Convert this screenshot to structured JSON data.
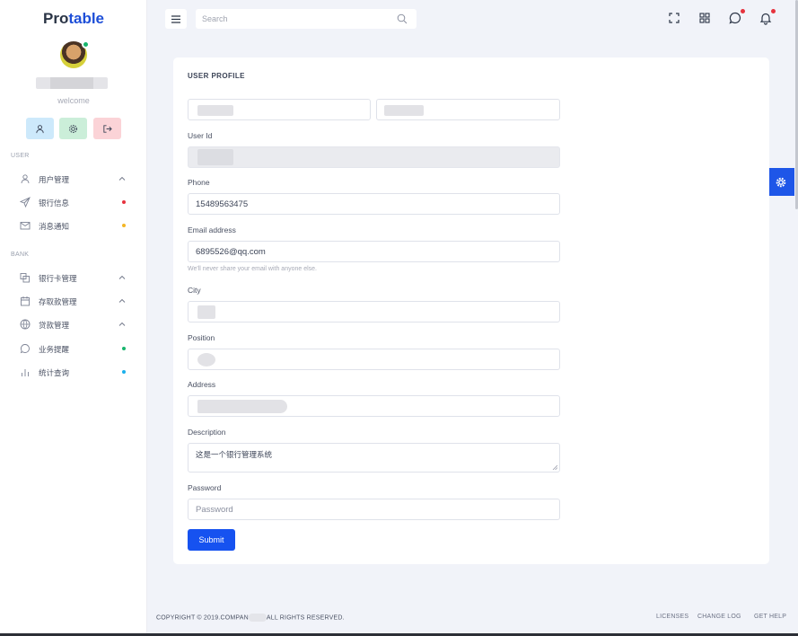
{
  "app": {
    "brand_prefix": "Pro",
    "brand_suffix": "table"
  },
  "profile": {
    "welcome": "welcome"
  },
  "sidebar": {
    "section_user": "USER",
    "section_bank": "BANK",
    "items": [
      {
        "label": "用户管理",
        "icon": "user-icon",
        "marker": "chevron",
        "color": ""
      },
      {
        "label": "银行信息",
        "icon": "send-icon",
        "marker": "dot",
        "color": "#e6323d"
      },
      {
        "label": "消息通知",
        "icon": "mail-icon",
        "marker": "dot",
        "color": "#f4b625"
      },
      {
        "label": "银行卡管理",
        "icon": "cards-icon",
        "marker": "chevron",
        "color": ""
      },
      {
        "label": "存取款管理",
        "icon": "calendar-icon",
        "marker": "chevron",
        "color": ""
      },
      {
        "label": "贷款管理",
        "icon": "globe-icon",
        "marker": "chevron",
        "color": ""
      },
      {
        "label": "业务提醒",
        "icon": "chat-icon",
        "marker": "dot",
        "color": "#18b56d"
      },
      {
        "label": "统计查询",
        "icon": "bar-chart-icon",
        "marker": "dot",
        "color": "#1ab0ec"
      }
    ]
  },
  "topbar": {
    "search_placeholder": "Search"
  },
  "form": {
    "title": "USER PROFILE",
    "labels": {
      "user_id": "User Id",
      "phone": "Phone",
      "email": "Email address",
      "city": "City",
      "position": "Position",
      "address": "Address",
      "description": "Description",
      "password": "Password"
    },
    "values": {
      "phone": "15489563475",
      "email": "6895526@qq.com",
      "description": "这是一个银行管理系统"
    },
    "email_hint": "We'll never share your email with anyone else.",
    "password_placeholder": "Password",
    "submit": "Submit"
  },
  "footer": {
    "copyright_left": "COPYRIGHT © 2019.COMPAN",
    "copyright_right": "ALL RIGHTS RESERVED.",
    "links": [
      "LICENSES",
      "CHANGE LOG",
      "GET HELP"
    ]
  },
  "colors": {
    "accent": "#1652f0",
    "brand": "#1e4fd8"
  }
}
